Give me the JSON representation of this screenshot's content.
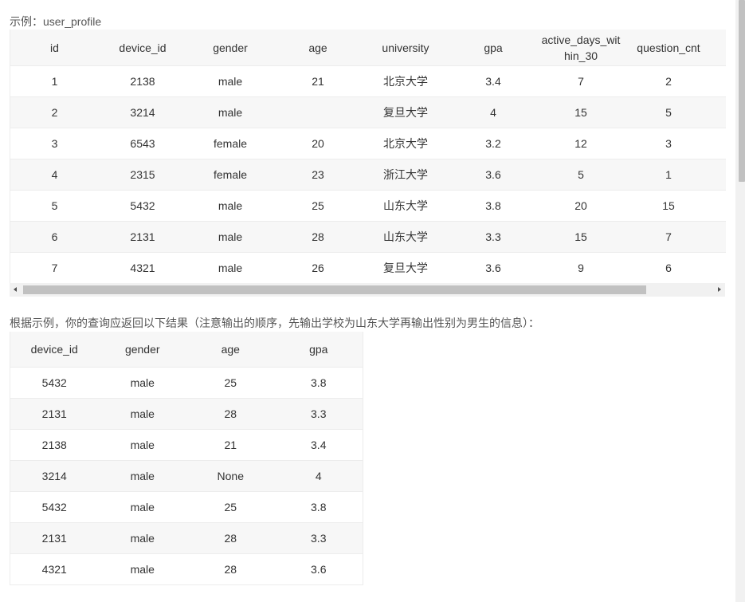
{
  "example_caption": "示例：user_profile",
  "table1": {
    "columns": [
      "id",
      "device_id",
      "gender",
      "age",
      "university",
      "gpa",
      "active_days_within_30",
      "question_cnt"
    ],
    "rows": [
      [
        "1",
        "2138",
        "male",
        "21",
        "北京大学",
        "3.4",
        "7",
        "2"
      ],
      [
        "2",
        "3214",
        "male",
        "",
        "复旦大学",
        "4",
        "15",
        "5"
      ],
      [
        "3",
        "6543",
        "female",
        "20",
        "北京大学",
        "3.2",
        "12",
        "3"
      ],
      [
        "4",
        "2315",
        "female",
        "23",
        "浙江大学",
        "3.6",
        "5",
        "1"
      ],
      [
        "5",
        "5432",
        "male",
        "25",
        "山东大学",
        "3.8",
        "20",
        "15"
      ],
      [
        "6",
        "2131",
        "male",
        "28",
        "山东大学",
        "3.3",
        "15",
        "7"
      ],
      [
        "7",
        "4321",
        "male",
        "26",
        "复旦大学",
        "3.6",
        "9",
        "6"
      ]
    ]
  },
  "result_caption": "根据示例，你的查询应返回以下结果（注意输出的顺序，先输出学校为山东大学再输出性别为男生的信息）：",
  "table2": {
    "columns": [
      "device_id",
      "gender",
      "age",
      "gpa"
    ],
    "rows": [
      [
        "5432",
        "male",
        "25",
        "3.8"
      ],
      [
        "2131",
        "male",
        "28",
        "3.3"
      ],
      [
        "2138",
        "male",
        "21",
        "3.4"
      ],
      [
        "3214",
        "male",
        "None",
        "4"
      ],
      [
        "5432",
        "male",
        "25",
        "3.8"
      ],
      [
        "2131",
        "male",
        "28",
        "3.3"
      ],
      [
        "4321",
        "male",
        "28",
        "3.6"
      ]
    ]
  }
}
